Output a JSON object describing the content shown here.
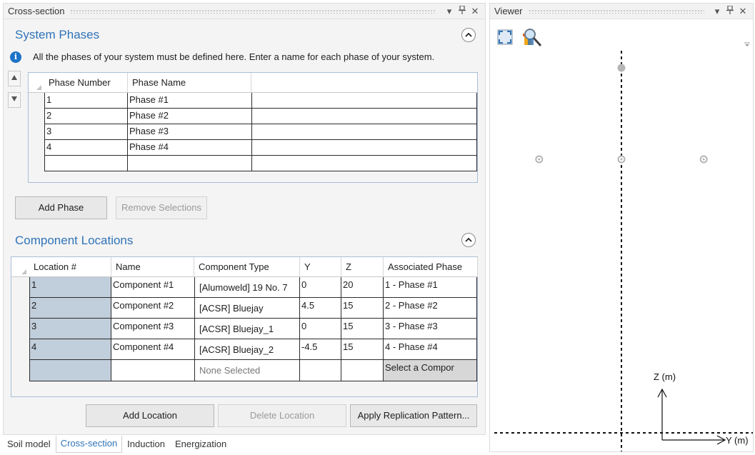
{
  "left_panel": {
    "title": "Cross-section",
    "controls": {
      "menu": "▾",
      "pin": "ᵽ",
      "close": "✕"
    }
  },
  "system_phases": {
    "title": "System Phases",
    "info_text": "All the phases of your system must be defined here. Enter a name for each phase of your system.",
    "columns": [
      "Phase Number",
      "Phase Name"
    ],
    "rows": [
      {
        "number": "1",
        "name": "Phase #1"
      },
      {
        "number": "2",
        "name": "Phase #2"
      },
      {
        "number": "3",
        "name": "Phase #3"
      },
      {
        "number": "4",
        "name": "Phase #4"
      }
    ],
    "add_button": "Add Phase",
    "remove_button": "Remove Selections"
  },
  "component_locations": {
    "title": "Component Locations",
    "columns": [
      "Location #",
      "Name",
      "Component Type",
      "Y",
      "Z",
      "Associated Phase"
    ],
    "rows": [
      {
        "location": "1",
        "name": "Component #1",
        "type": "[Alumoweld] 19 No. 7",
        "y": "0",
        "z": "20",
        "phase": "1 - Phase #1"
      },
      {
        "location": "2",
        "name": "Component #2",
        "type": "[ACSR] Bluejay",
        "y": "4.5",
        "z": "15",
        "phase": "2 - Phase #2"
      },
      {
        "location": "3",
        "name": "Component #3",
        "type": "[ACSR] Bluejay_1",
        "y": "0",
        "z": "15",
        "phase": "3 - Phase #3"
      },
      {
        "location": "4",
        "name": "Component #4",
        "type": "[ACSR] Bluejay_2",
        "y": "-4.5",
        "z": "15",
        "phase": "4 - Phase #4"
      }
    ],
    "new_row": {
      "type_placeholder": "None Selected",
      "phase_placeholder": "Select a Compor"
    },
    "add_button": "Add Location",
    "delete_button": "Delete Location",
    "replicate_button": "Apply Replication Pattern..."
  },
  "bottom_tabs": [
    "Soil model",
    "Cross-section",
    "Induction",
    "Energization"
  ],
  "active_tab": "Cross-section",
  "viewer": {
    "title": "Viewer",
    "tools": [
      "fit-to-view-icon",
      "zoom-search-icon"
    ],
    "z_axis_label": "Z (m)",
    "y_axis_label": "Y (m)",
    "points": [
      {
        "y": 0,
        "z": 20
      },
      {
        "y": 4.5,
        "z": 15
      },
      {
        "y": 0,
        "z": 15
      },
      {
        "y": -4.5,
        "z": 15
      }
    ]
  },
  "colors": {
    "accent": "#2f73b8",
    "grid_border": "#a9bfd6",
    "location_shade": "#c1cedb",
    "point": "#b5b5b5"
  }
}
